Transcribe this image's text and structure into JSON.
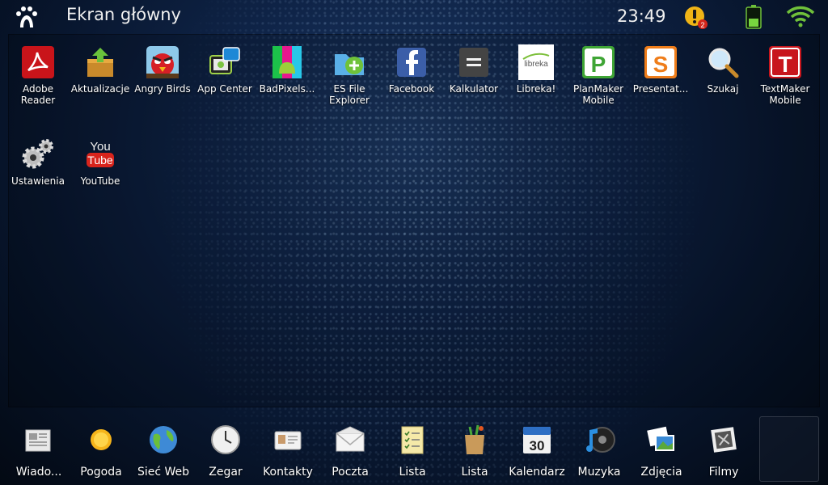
{
  "status": {
    "title": "Ekran główny",
    "time": "23:49",
    "notification_count": "2"
  },
  "apps": [
    {
      "label": "Adobe\nReader"
    },
    {
      "label": "Aktualizacje"
    },
    {
      "label": "Angry Birds"
    },
    {
      "label": "App Center"
    },
    {
      "label": "BadPixels..."
    },
    {
      "label": "ES File\nExplorer"
    },
    {
      "label": "Facebook"
    },
    {
      "label": "Kalkulator"
    },
    {
      "label": "Libreka!"
    },
    {
      "label": "PlanMaker\nMobile"
    },
    {
      "label": "Presentat..."
    },
    {
      "label": "Szukaj"
    },
    {
      "label": "TextMaker\nMobile"
    },
    {
      "label": "Ustawienia"
    },
    {
      "label": "YouTube"
    }
  ],
  "dock": [
    {
      "label": "Wiado..."
    },
    {
      "label": "Pogoda"
    },
    {
      "label": "Sieć Web"
    },
    {
      "label": "Zegar"
    },
    {
      "label": "Kontakty"
    },
    {
      "label": "Poczta"
    },
    {
      "label": "Lista"
    },
    {
      "label": "Lista"
    },
    {
      "label": "Kalendarz"
    },
    {
      "label": "Muzyka"
    },
    {
      "label": "Zdjęcia"
    },
    {
      "label": "Filmy"
    }
  ],
  "icon_text": {
    "youtube_top": "You",
    "youtube_bottom": "Tube",
    "planmaker_letter": "P",
    "presentations_letter": "S",
    "textmaker_letter": "T",
    "libreka_text": "libreka",
    "calendar_day": "30"
  }
}
